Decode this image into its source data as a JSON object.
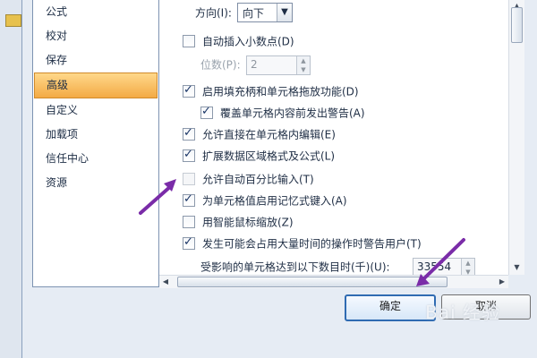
{
  "left_options": [
    "公式",
    "校对",
    "保存",
    "高级",
    "自定义",
    "加载项",
    "信任中心",
    "资源"
  ],
  "selected_option_index": 3,
  "settings": {
    "direction_label": "方向(I):",
    "direction_value": "向下",
    "auto_decimal_label": "自动插入小数点(D)",
    "places_label": "位数(P):",
    "places_value": "2",
    "fill_handle_label": "启用填充柄和单元格拖放功能(D)",
    "alert_overwrite_label": "覆盖单元格内容前发出警告(A)",
    "direct_edit_label": "允许直接在单元格内编辑(E)",
    "extend_formats_label": "扩展数据区域格式及公式(L)",
    "auto_percent_label": "允许自动百分比输入(T)",
    "autocomplete_label": "为单元格值启用记忆式键入(A)",
    "intellimouse_label": "用智能鼠标缩放(Z)",
    "time_consuming_label": "发生可能会占用大量时间的操作时警告用户(T)",
    "cells_affected_label": "受影响的单元格达到以下数目时(千)(U):",
    "cells_affected_value": "33554"
  },
  "checkbox_states": {
    "auto_decimal": false,
    "fill_handle": true,
    "alert_overwrite": true,
    "direct_edit": true,
    "extend_formats": true,
    "auto_percent": false,
    "autocomplete": true,
    "intellimouse": false,
    "time_consuming": true
  },
  "buttons": {
    "ok": "确定",
    "cancel": "取消"
  },
  "watermark": "Bai 经验",
  "colors": {
    "selection_gradient_top": "#ffd88a",
    "selection_gradient_bottom": "#f3aa45",
    "annotation_arrow": "#7a2ca8"
  },
  "icons": {
    "dropdown": "chevron-down-icon",
    "spin": "spinner-icon",
    "scroll_up": "arrow-up-icon",
    "scroll_down": "arrow-down-icon",
    "scroll_left": "arrow-left-icon",
    "scroll_right": "arrow-right-icon"
  }
}
